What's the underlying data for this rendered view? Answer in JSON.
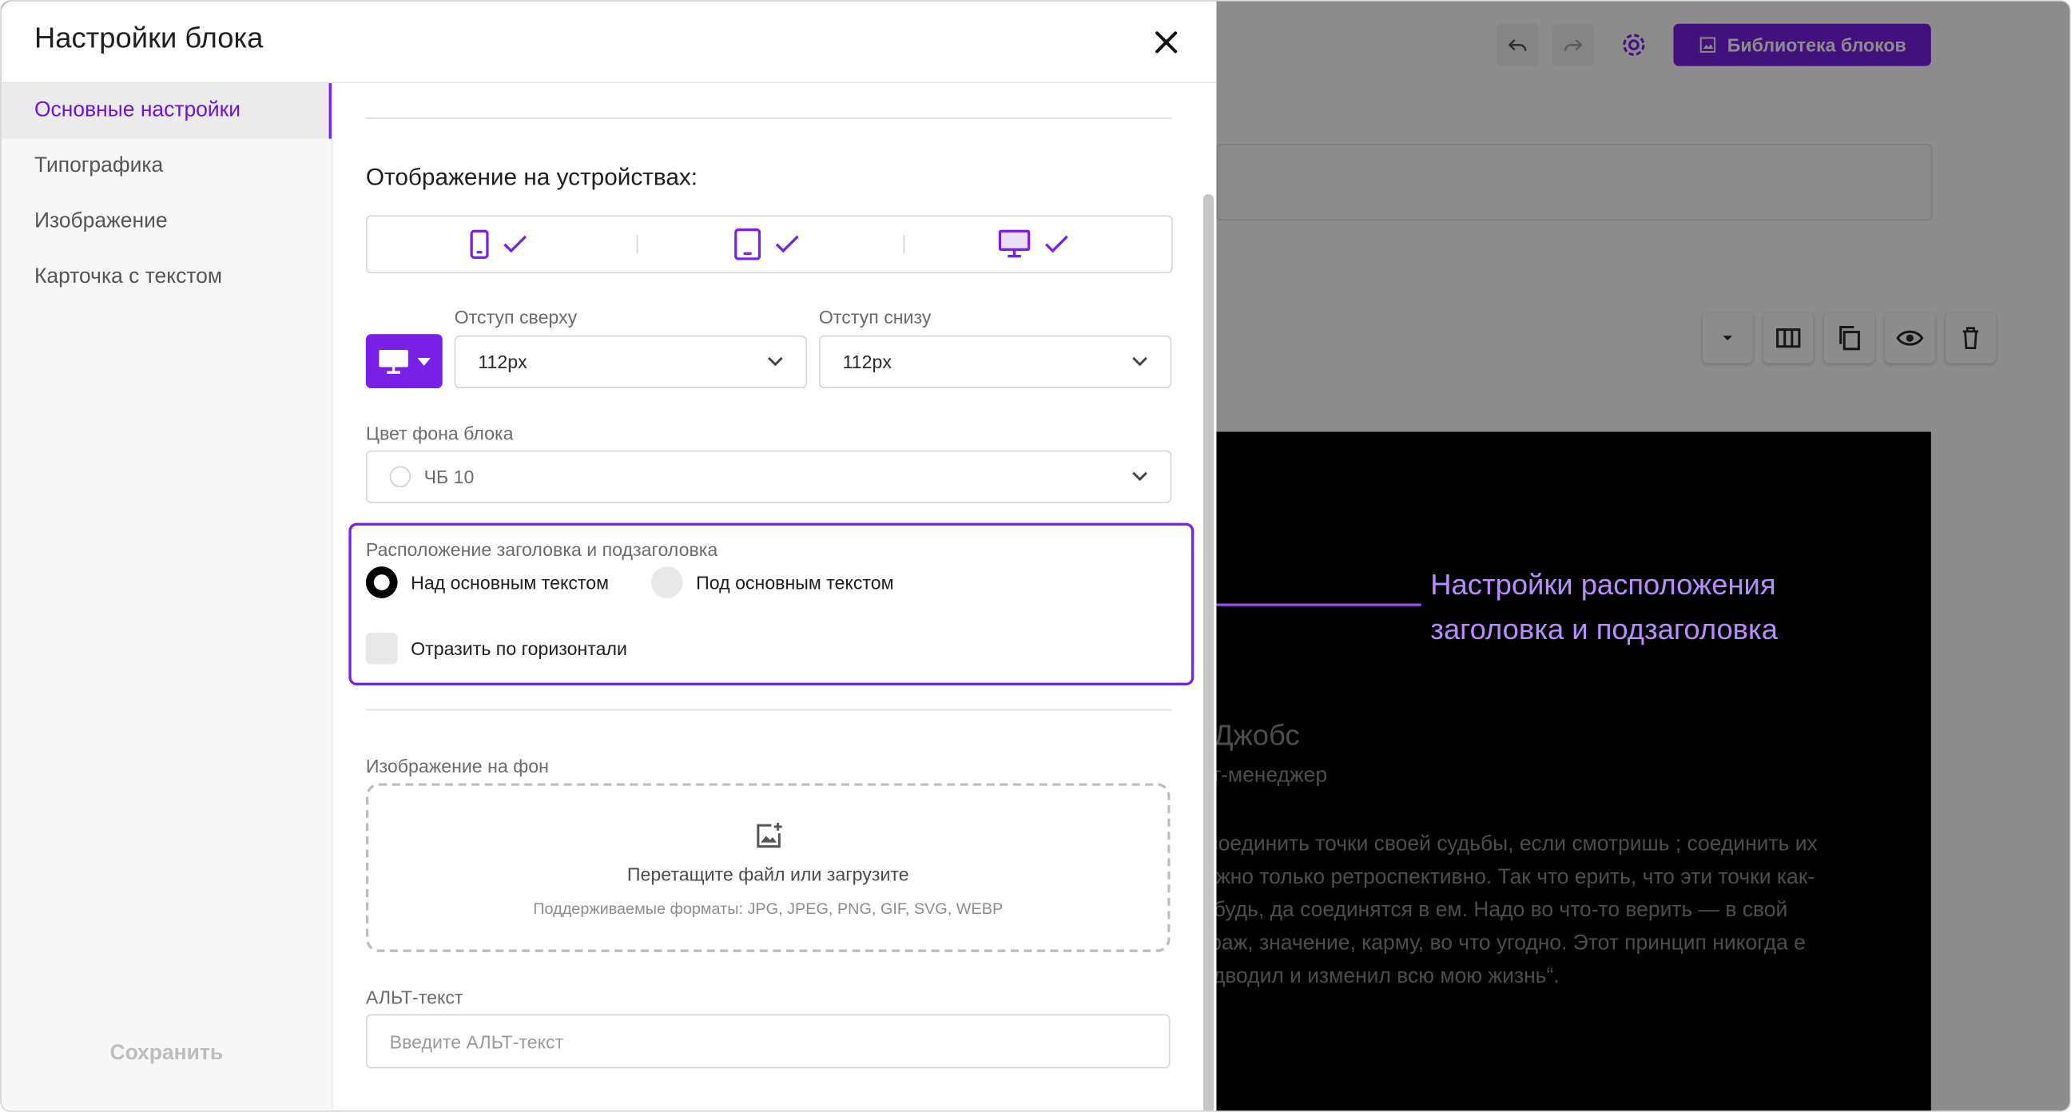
{
  "colors": {
    "accent": "#7a1fe6",
    "callout": "#b98cff",
    "overlay": "rgba(0,0,0,0.45)"
  },
  "modal": {
    "title": "Настройки блока",
    "close_icon": "close-icon"
  },
  "sidebar": {
    "items": [
      {
        "label": "Основные настройки",
        "active": true
      },
      {
        "label": "Типографика",
        "active": false
      },
      {
        "label": "Изображение",
        "active": false
      },
      {
        "label": "Карточка с текстом",
        "active": false
      }
    ],
    "save_label": "Сохранить"
  },
  "devices": {
    "title": "Отображение на устройствах:",
    "items": [
      {
        "icon": "phone-icon",
        "checked": true
      },
      {
        "icon": "tablet-icon",
        "checked": true
      },
      {
        "icon": "desktop-icon",
        "checked": true
      }
    ]
  },
  "spacing": {
    "device_icon": "desktop-icon",
    "top_label": "Отступ сверху",
    "top_value": "112px",
    "bottom_label": "Отступ снизу",
    "bottom_value": "112px"
  },
  "background": {
    "label": "Цвет фона блока",
    "value": "ЧБ 10"
  },
  "heading_position": {
    "label": "Расположение заголовка и подзаголовка",
    "options": [
      {
        "label": "Над основным текстом",
        "selected": true
      },
      {
        "label": "Под основным текстом",
        "selected": false
      }
    ],
    "mirror_label": "Отразить по горизонтали",
    "mirror_checked": false
  },
  "bg_image": {
    "label": "Изображение на фон",
    "drop_text": "Перетащите файл или загрузите",
    "formats": "Поддерживаемые форматы: JPG, JPEG, PNG, GIF, SVG, WEBP"
  },
  "alt_text": {
    "label": "АЛЬТ-текст",
    "placeholder": "Введите АЛЬТ-текст"
  },
  "editor": {
    "library_button": "Библиотека блоков",
    "preview": {
      "name": "в Джобс",
      "role": "ект-менеджер",
      "quote": "я соединить точки своей судьбы, если смотришь ; соединить их можно только ретроспективно. Так что ерить, что эти точки как-нибудь, да соединятся в ем. Надо во что-то верить — в свой кураж, значение, карму, во что угодно. Этот принцип никогда е подводил и изменил всю мою жизнь“."
    }
  },
  "annotation": {
    "text": "Настройки расположения заголовка и подзаголовка"
  }
}
